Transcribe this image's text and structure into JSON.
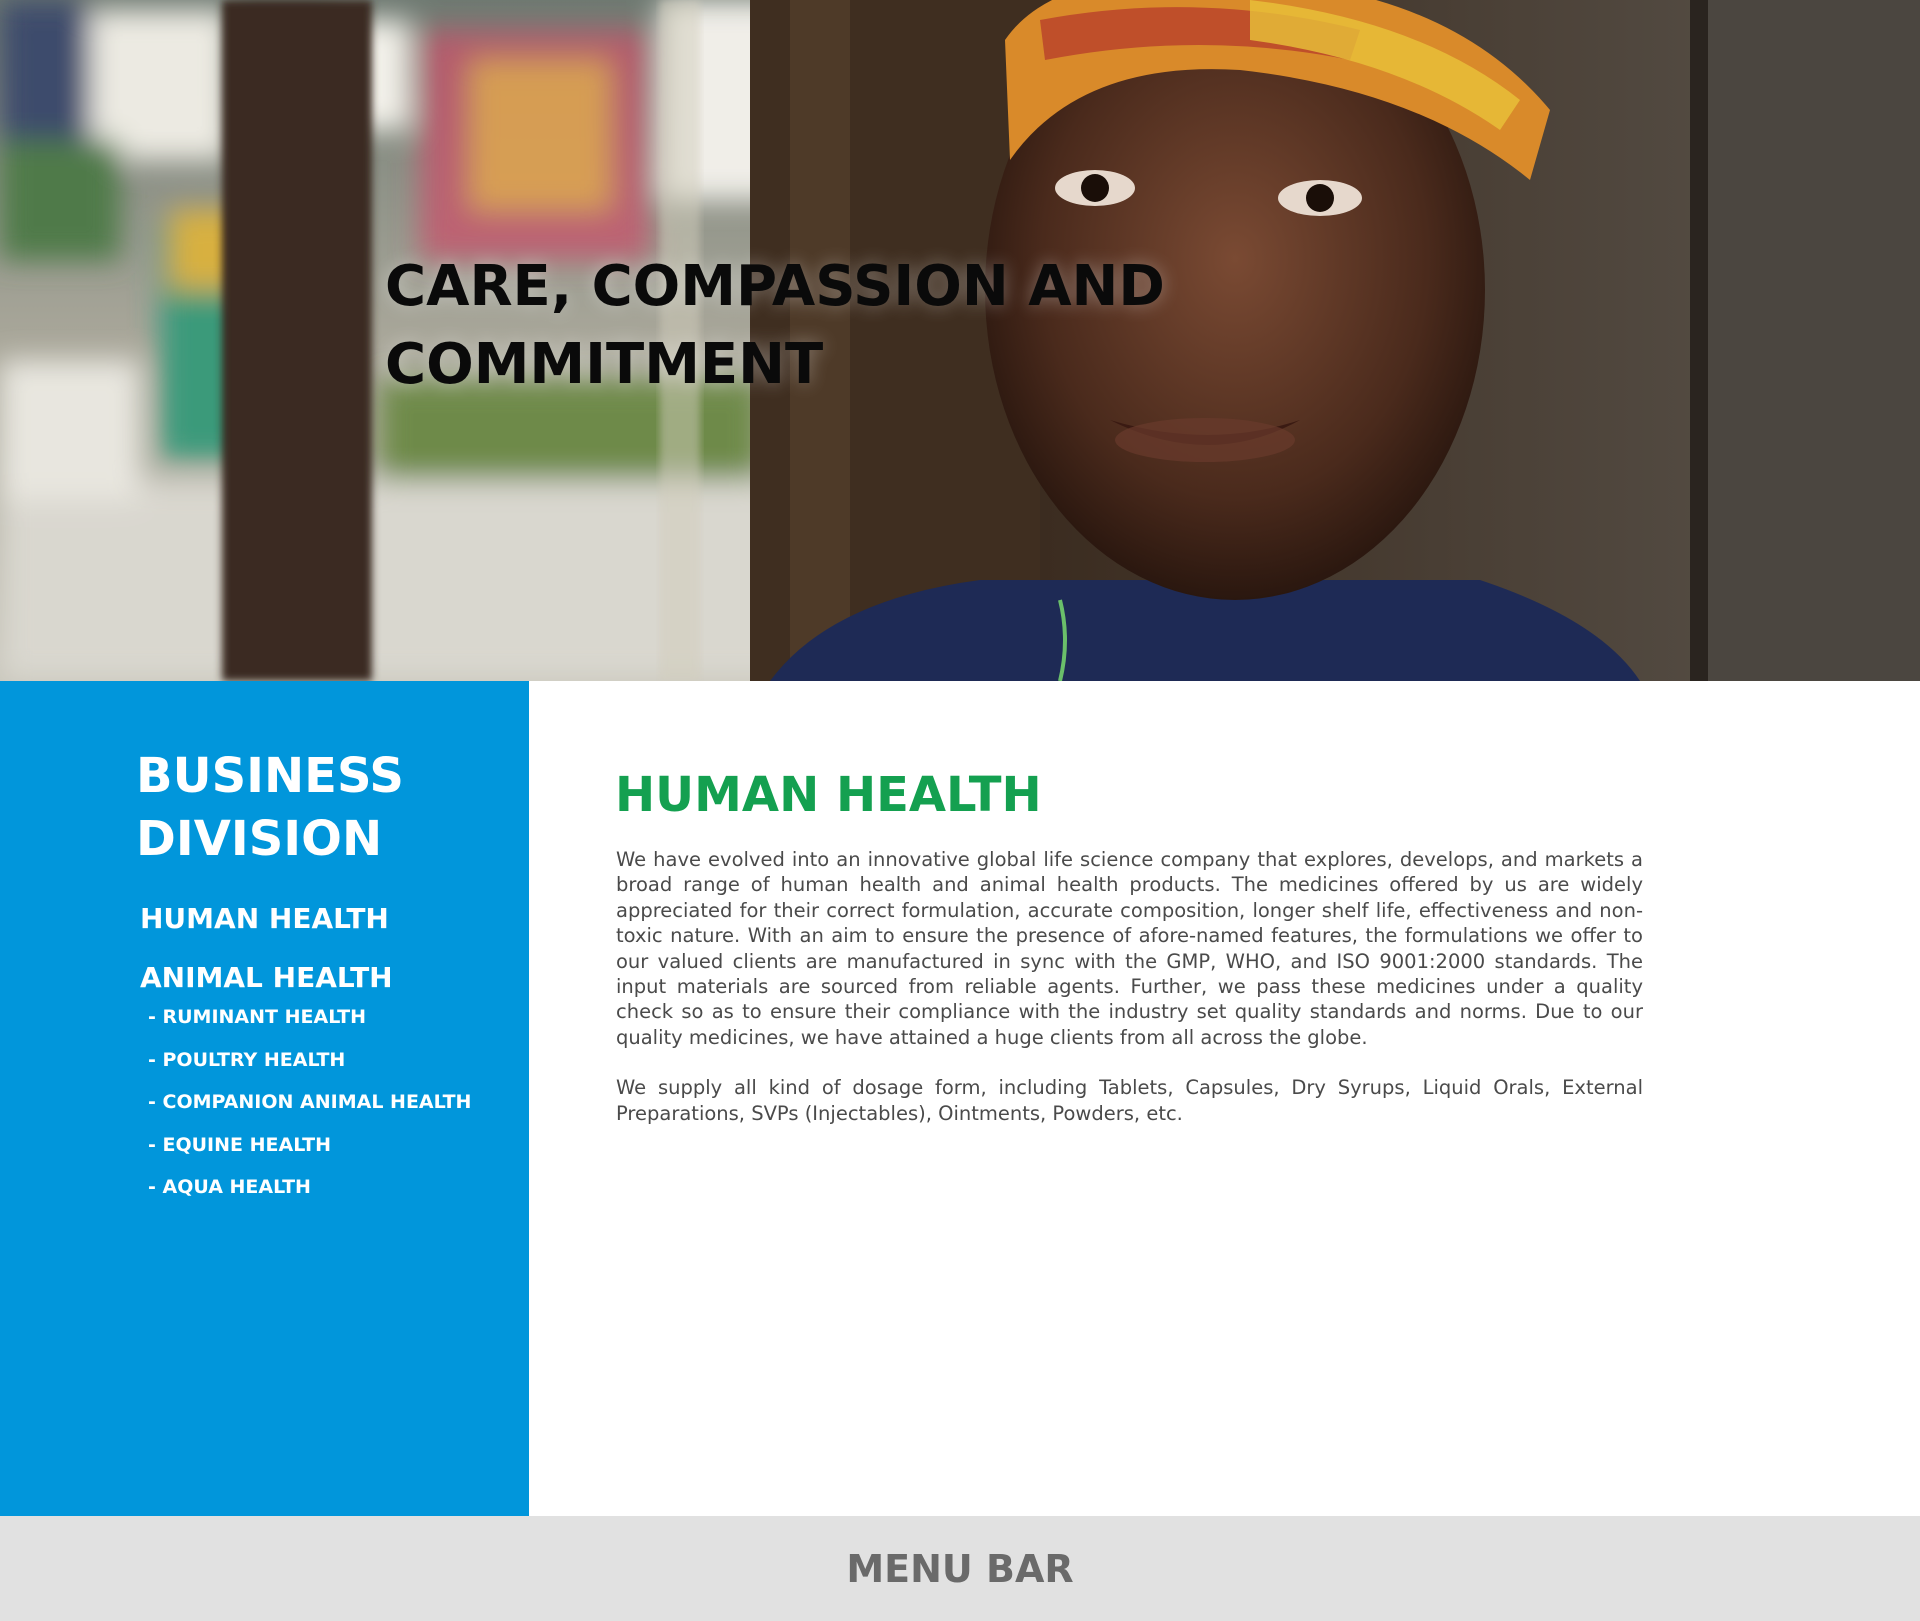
{
  "hero": {
    "title": "CARE, COMPASSION AND COMMITMENT"
  },
  "sidebar": {
    "title": "BUSINESS DIVISION",
    "items": [
      {
        "label": "HUMAN HEALTH"
      },
      {
        "label": "ANIMAL HEALTH"
      }
    ],
    "subitems": [
      {
        "label": "- RUMINANT HEALTH"
      },
      {
        "label": "- POULTRY HEALTH"
      },
      {
        "label": "- COMPANION ANIMAL HEALTH"
      },
      {
        "label": "- EQUINE HEALTH"
      },
      {
        "label": "- AQUA HEALTH"
      }
    ]
  },
  "main": {
    "title": "HUMAN HEALTH",
    "paragraphs": [
      "We have evolved into an innovative global life science company that explores, develops, and markets a broad range of human health and animal health products. The medicines offered by us are widely appreciated for their correct formulation, accurate composition, longer shelf life, effectiveness and non-toxic nature. With an aim to ensure the presence of afore-named features, the formulations we offer to our valued clients are manufactured in sync with the GMP, WHO, and ISO 9001:2000 standards. The input materials are sourced from reliable agents. Further, we pass these medicines under a quality check so as to ensure their compliance with the industry set quality standards and norms. Due to our quality medicines, we have attained a huge clients from all across the globe.",
      "We supply all kind of dosage form, including Tablets, Capsules, Dry Syrups, Liquid Orals, External Preparations, SVPs (Injectables), Ointments, Powders, etc."
    ]
  },
  "menu_bar": {
    "label": "MENU BAR"
  },
  "colors": {
    "sidebar_bg": "#0196db",
    "content_title": "#14a050",
    "menu_bar_bg": "#e1e1e1",
    "menu_bar_text": "#6a6a6a"
  }
}
